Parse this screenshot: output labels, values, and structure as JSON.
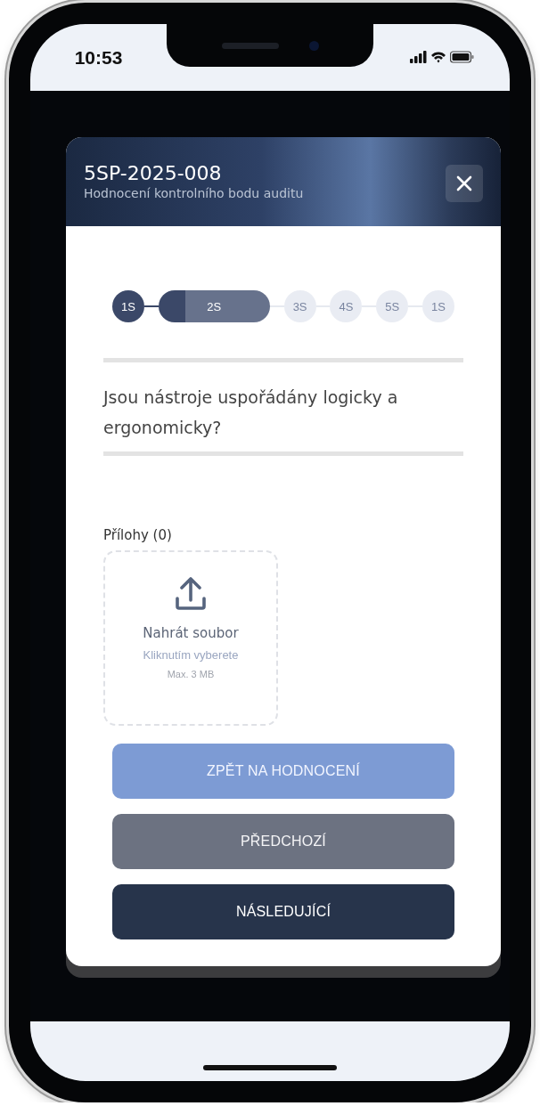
{
  "status_bar": {
    "time": "10:53"
  },
  "modal": {
    "title": "5SP-2025-008",
    "subtitle": "Hodnocení kontrolního bodu auditu"
  },
  "steps": [
    {
      "label": "1S",
      "completed": true,
      "selected": false
    },
    {
      "label": "2S",
      "completed": false,
      "selected": true
    },
    {
      "label": "3S",
      "completed": false,
      "selected": false
    },
    {
      "label": "4S",
      "completed": false,
      "selected": false
    },
    {
      "label": "5S",
      "completed": false,
      "selected": false
    },
    {
      "label": "1S",
      "completed": false,
      "selected": false
    }
  ],
  "question": "Jsou nástroje uspořádány logicky a ergonomicky?",
  "attachments": {
    "label": "Přílohy (0)",
    "upload_title": "Nahrát soubor",
    "upload_hint": "Kliknutím vyberete",
    "upload_limit": "Max. 3 MB"
  },
  "buttons": [
    {
      "label": "ZPĚT NA HODNOCENÍ",
      "kind": "secondary"
    },
    {
      "label": "PŘEDCHOZÍ",
      "kind": "neutral"
    },
    {
      "label": "NÁSLEDUJÍCÍ",
      "kind": "primary"
    }
  ]
}
